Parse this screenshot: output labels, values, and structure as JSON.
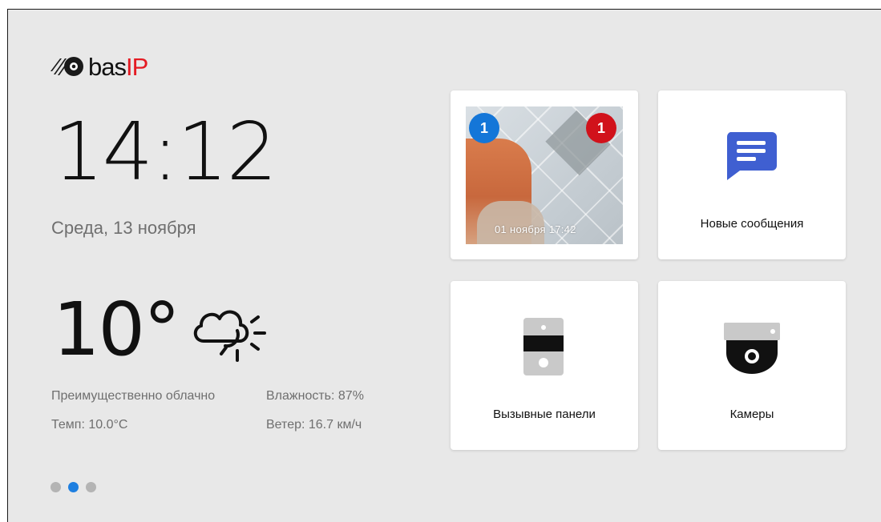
{
  "brand": {
    "text_main": "bas",
    "text_accent": "IP",
    "accent_color": "#e41b23",
    "logo_icon": "basip-logo-icon"
  },
  "clock": {
    "time": "14:12",
    "date": "Среда, 13 ноября"
  },
  "weather": {
    "temperature": "10°",
    "icon": "cloud-sun-icon",
    "condition": "Преимущественно облачно",
    "humidity": "Влажность: 87%",
    "temp_detail": "Темп: 10.0°С",
    "wind": "Ветер: 16.7 км/ч"
  },
  "pager": {
    "count": 3,
    "active_index": 1,
    "active_color": "#1e7fe0"
  },
  "tiles": {
    "snapshot": {
      "timestamp": "01 ноября 17:42",
      "badge_left": "1",
      "badge_right": "1",
      "badge_left_color": "#1476d8",
      "badge_right_color": "#d1121b"
    },
    "messages": {
      "label": "Новые сообщения",
      "icon": "message-icon",
      "icon_color": "#3f5fd1"
    },
    "panels": {
      "label": "Вызывные панели",
      "icon": "call-panel-icon"
    },
    "cameras": {
      "label": "Камеры",
      "icon": "dome-camera-icon"
    }
  }
}
